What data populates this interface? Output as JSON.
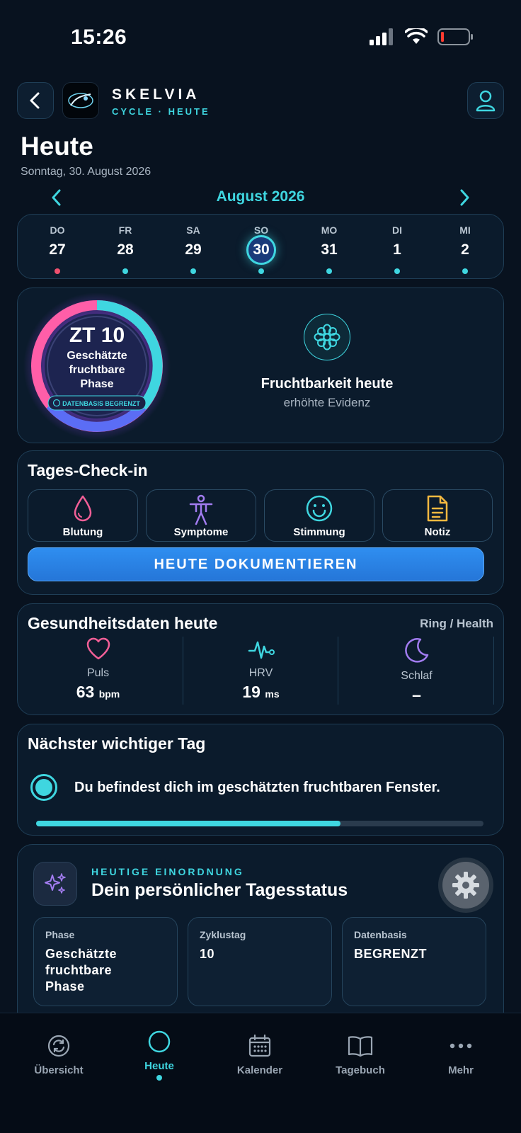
{
  "status_bar": {
    "time": "15:26"
  },
  "header": {
    "brand_name": "SKELVIA",
    "brand_sub": "CYCLE · HEUTE"
  },
  "page": {
    "title": "Heute",
    "date": "Sonntag, 30. August 2026"
  },
  "calendar": {
    "month": "August 2026",
    "days": [
      {
        "abbr": "DO",
        "num": "27",
        "dot": "#f0506e"
      },
      {
        "abbr": "FR",
        "num": "28",
        "dot": "#3fd6e0"
      },
      {
        "abbr": "SA",
        "num": "29",
        "dot": "#3fd6e0"
      },
      {
        "abbr": "SO",
        "num": "30",
        "dot": "#3fd6e0",
        "selected": true
      },
      {
        "abbr": "MO",
        "num": "31",
        "dot": "#3fd6e0"
      },
      {
        "abbr": "DI",
        "num": "1",
        "dot": "#3fd6e0"
      },
      {
        "abbr": "MI",
        "num": "2",
        "dot": "#3fd6e0"
      }
    ]
  },
  "cycle_ring": {
    "day_label": "ZT 10",
    "phase_line1": "Geschätzte",
    "phase_line2": "fruchtbare",
    "phase_line3": "Phase",
    "badge": "DATENBASIS BEGRENZT"
  },
  "fertility": {
    "title": "Fruchtbarkeit heute",
    "subtitle": "erhöhte Evidenz",
    "icon": "flower-icon"
  },
  "checkin": {
    "title": "Tages-Check-in",
    "items": [
      {
        "label": "Blutung",
        "icon": "drop-icon",
        "color": "#f25f97"
      },
      {
        "label": "Symptome",
        "icon": "body-icon",
        "color": "#a27cf0"
      },
      {
        "label": "Stimmung",
        "icon": "smile-icon",
        "color": "#3fd6e0"
      },
      {
        "label": "Notiz",
        "icon": "note-icon",
        "color": "#f5b940"
      }
    ],
    "cta": "HEUTE DOKUMENTIEREN"
  },
  "health": {
    "title": "Gesundheitsdaten heute",
    "source": "Ring / Health",
    "metrics": [
      {
        "label": "Puls",
        "value": "63",
        "unit": "bpm",
        "icon": "heart-icon"
      },
      {
        "label": "HRV",
        "value": "19",
        "unit": "ms",
        "icon": "pulse-icon"
      },
      {
        "label": "Schlaf",
        "value": "–",
        "unit": "",
        "icon": "moon-icon"
      }
    ]
  },
  "next_day": {
    "title": "Nächster wichtiger Tag",
    "message": "Du befindest dich im geschätzten fruchtbaren Fenster.",
    "progress": 0.68
  },
  "status_card": {
    "eyebrow": "HEUTIGE EINORDNUNG",
    "title": "Dein persönlicher Tagesstatus",
    "stats": [
      {
        "label": "Phase",
        "value": "Geschätzte\nfruchtbare\nPhase"
      },
      {
        "label": "Zyklustag",
        "value": "10"
      },
      {
        "label": "Datenbasis",
        "value": "BEGRENZT"
      }
    ]
  },
  "tabbar": {
    "items": [
      {
        "label": "Übersicht",
        "icon": "refresh-icon",
        "active": false
      },
      {
        "label": "Heute",
        "icon": "circle-icon",
        "active": true
      },
      {
        "label": "Kalender",
        "icon": "calendar-icon",
        "active": false
      },
      {
        "label": "Tagebuch",
        "icon": "book-icon",
        "active": false
      },
      {
        "label": "Mehr",
        "icon": "more-icon",
        "active": false
      }
    ]
  },
  "colors": {
    "accent": "#3fd6e0",
    "primary_button": "#2f8ef0",
    "background": "#08121f",
    "card": "#0b1b2c"
  }
}
